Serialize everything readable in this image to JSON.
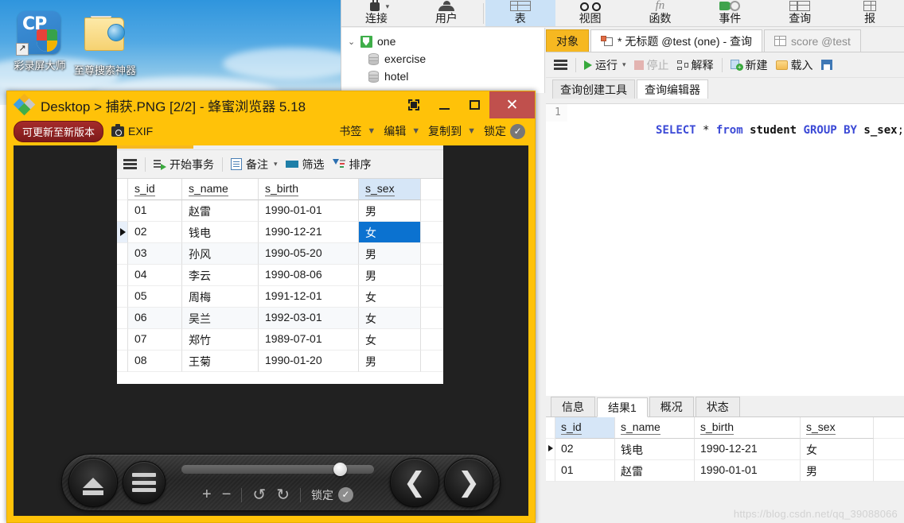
{
  "desktop": {
    "icons": [
      {
        "name": "cp-recorder",
        "label": "彩录屏大师"
      },
      {
        "name": "search-tool-folder",
        "label": "至尊搜索神器"
      }
    ]
  },
  "bgapp": {
    "ribbon": [
      {
        "label": "连接",
        "icon": "connection-icon",
        "selected": false
      },
      {
        "label": "用户",
        "icon": "user-icon",
        "selected": false
      },
      {
        "label": "表",
        "icon": "table-icon",
        "selected": true
      },
      {
        "label": "视图",
        "icon": "view-icon",
        "selected": false
      },
      {
        "label": "函数",
        "icon": "function-icon",
        "selected": false
      },
      {
        "label": "事件",
        "icon": "event-icon",
        "selected": false
      },
      {
        "label": "查询",
        "icon": "query-icon",
        "selected": false
      },
      {
        "label": "报",
        "icon": "report-icon",
        "selected": false
      }
    ],
    "tree": {
      "connection": "one",
      "databases": [
        "exercise",
        "hotel"
      ]
    },
    "object_tabs": [
      {
        "label": "对象",
        "style": "amber"
      },
      {
        "label": "* 无标题 @test (one) - 查询",
        "style": "active"
      },
      {
        "label": "score @test",
        "style": "inactive"
      }
    ],
    "query_toolbar": {
      "menu": "",
      "run": "运行",
      "stop": "停止",
      "explain": "解释",
      "new": "新建",
      "load": "载入"
    },
    "sub_tabs": [
      {
        "label": "查询创建工具",
        "active": false
      },
      {
        "label": "查询编辑器",
        "active": true
      }
    ],
    "editor": {
      "line_number": "1",
      "sql_tokens": [
        {
          "t": "SELECT",
          "k": "kw"
        },
        {
          "t": " ",
          "k": "punct"
        },
        {
          "t": "*",
          "k": "punct"
        },
        {
          "t": " ",
          "k": "punct"
        },
        {
          "t": "from",
          "k": "kw"
        },
        {
          "t": " ",
          "k": "punct"
        },
        {
          "t": "student",
          "k": "id"
        },
        {
          "t": " ",
          "k": "punct"
        },
        {
          "t": "GROUP BY",
          "k": "kw"
        },
        {
          "t": " ",
          "k": "punct"
        },
        {
          "t": "s_sex",
          "k": "id"
        },
        {
          "t": ";",
          "k": "punct"
        }
      ]
    },
    "result_tabs": [
      {
        "label": "信息",
        "active": false
      },
      {
        "label": "结果1",
        "active": true
      },
      {
        "label": "概况",
        "active": false
      },
      {
        "label": "状态",
        "active": false
      }
    ],
    "result_grid": {
      "columns": [
        "s_id",
        "s_name",
        "s_birth",
        "s_sex"
      ],
      "highlight_column": "s_id",
      "rows": [
        {
          "current": true,
          "cells": [
            "02",
            "钱电",
            "1990-12-21",
            "女"
          ]
        },
        {
          "current": false,
          "cells": [
            "01",
            "赵雷",
            "1990-01-01",
            "男"
          ]
        }
      ]
    },
    "watermark": "https://blog.csdn.net/qq_39088066"
  },
  "viewer": {
    "title": "Desktop > 捕获.PNG [2/2] - 蜂蜜浏览器 5.18",
    "window_buttons": [
      {
        "name": "snapshot-button",
        "glyph": ""
      },
      {
        "name": "minimize-button",
        "glyph": ""
      },
      {
        "name": "maximize-button",
        "glyph": ""
      },
      {
        "name": "close-button",
        "glyph": "✕"
      }
    ],
    "toolbar": {
      "update_pill": "可更新至新版本",
      "exif": "EXIF",
      "bookmark": "书签",
      "edit": "编辑",
      "copy_to": "复制到",
      "lock": "锁定",
      "caret": "▼",
      "check": "✓"
    },
    "controls": {
      "eject": "eject-button",
      "menu": "menu-button",
      "zoom_in": "+",
      "zoom_out": "−",
      "rotate_ccw": "↺",
      "rotate_cw": "↻",
      "lock_label": "锁定",
      "lock_check": "✓",
      "prev": "❮",
      "next": "❯"
    }
  },
  "shot": {
    "toolbar": {
      "menu": "",
      "begin_transaction": "开始事务",
      "note": "备注",
      "note_caret": "▾",
      "filter": "筛选",
      "sort": "排序"
    },
    "grid": {
      "columns": [
        "s_id",
        "s_name",
        "s_birth",
        "s_sex"
      ],
      "highlight_column": "s_sex",
      "rows": [
        {
          "current": false,
          "alt": false,
          "selected_col": null,
          "cells": [
            "01",
            "赵雷",
            "1990-01-01",
            "男"
          ]
        },
        {
          "current": true,
          "alt": false,
          "selected_col": 3,
          "cells": [
            "02",
            "钱电",
            "1990-12-21",
            "女"
          ]
        },
        {
          "current": false,
          "alt": true,
          "selected_col": null,
          "cells": [
            "03",
            "孙风",
            "1990-05-20",
            "男"
          ]
        },
        {
          "current": false,
          "alt": false,
          "selected_col": null,
          "cells": [
            "04",
            "李云",
            "1990-08-06",
            "男"
          ]
        },
        {
          "current": false,
          "alt": false,
          "selected_col": null,
          "cells": [
            "05",
            "周梅",
            "1991-12-01",
            "女"
          ]
        },
        {
          "current": false,
          "alt": true,
          "selected_col": null,
          "cells": [
            "06",
            "吴兰",
            "1992-03-01",
            "女"
          ]
        },
        {
          "current": false,
          "alt": false,
          "selected_col": null,
          "cells": [
            "07",
            "郑竹",
            "1989-07-01",
            "女"
          ]
        },
        {
          "current": false,
          "alt": false,
          "selected_col": null,
          "cells": [
            "08",
            "王菊",
            "1990-01-20",
            "男"
          ]
        }
      ]
    }
  },
  "colors": {
    "viewer_chrome": "#ffc209",
    "close_button": "#c0504d",
    "selection_blue": "#0b72d0",
    "header_highlight": "#d6e6f7",
    "ribbon_selected": "#cbe2f7",
    "keyword_blue": "#3b49d6",
    "canvas_dark": "#212121"
  }
}
